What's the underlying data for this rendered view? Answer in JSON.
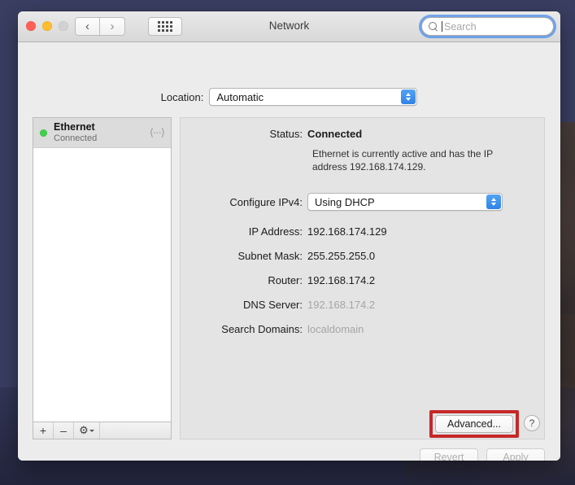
{
  "window": {
    "title": "Network",
    "traffic_lights": [
      "close",
      "minimize",
      "zoom"
    ],
    "nav_back": "‹",
    "nav_forward": "›",
    "show_all": "show-all-grid"
  },
  "search": {
    "placeholder": "Search",
    "value": "",
    "icon": "search-icon"
  },
  "location": {
    "label": "Location:",
    "value": "Automatic"
  },
  "sidebar": {
    "services": [
      {
        "name": "Ethernet",
        "state": "Connected",
        "status_color": "#3fd14b",
        "icon": "ethernet-interface-icon"
      }
    ],
    "toolbar": {
      "add": "+",
      "remove": "–",
      "gear": "⚙",
      "gear_chevron": "chevron-down-icon"
    }
  },
  "detail": {
    "status": {
      "label": "Status:",
      "value": "Connected",
      "description": "Ethernet is currently active and has the IP address 192.168.174.129."
    },
    "configure_ipv4": {
      "label": "Configure IPv4:",
      "value": "Using DHCP"
    },
    "fields": [
      {
        "label": "IP Address:",
        "value": "192.168.174.129",
        "dim": false
      },
      {
        "label": "Subnet Mask:",
        "value": "255.255.255.0",
        "dim": false
      },
      {
        "label": "Router:",
        "value": "192.168.174.2",
        "dim": false
      },
      {
        "label": "DNS Server:",
        "value": "192.168.174.2",
        "dim": true
      },
      {
        "label": "Search Domains:",
        "value": "localdomain",
        "dim": true
      }
    ],
    "advanced_button": "Advanced...",
    "help_button": "?"
  },
  "footer": {
    "revert": "Revert",
    "apply": "Apply"
  },
  "annotation": {
    "highlight_color": "#c62828",
    "target": "advanced-button"
  }
}
